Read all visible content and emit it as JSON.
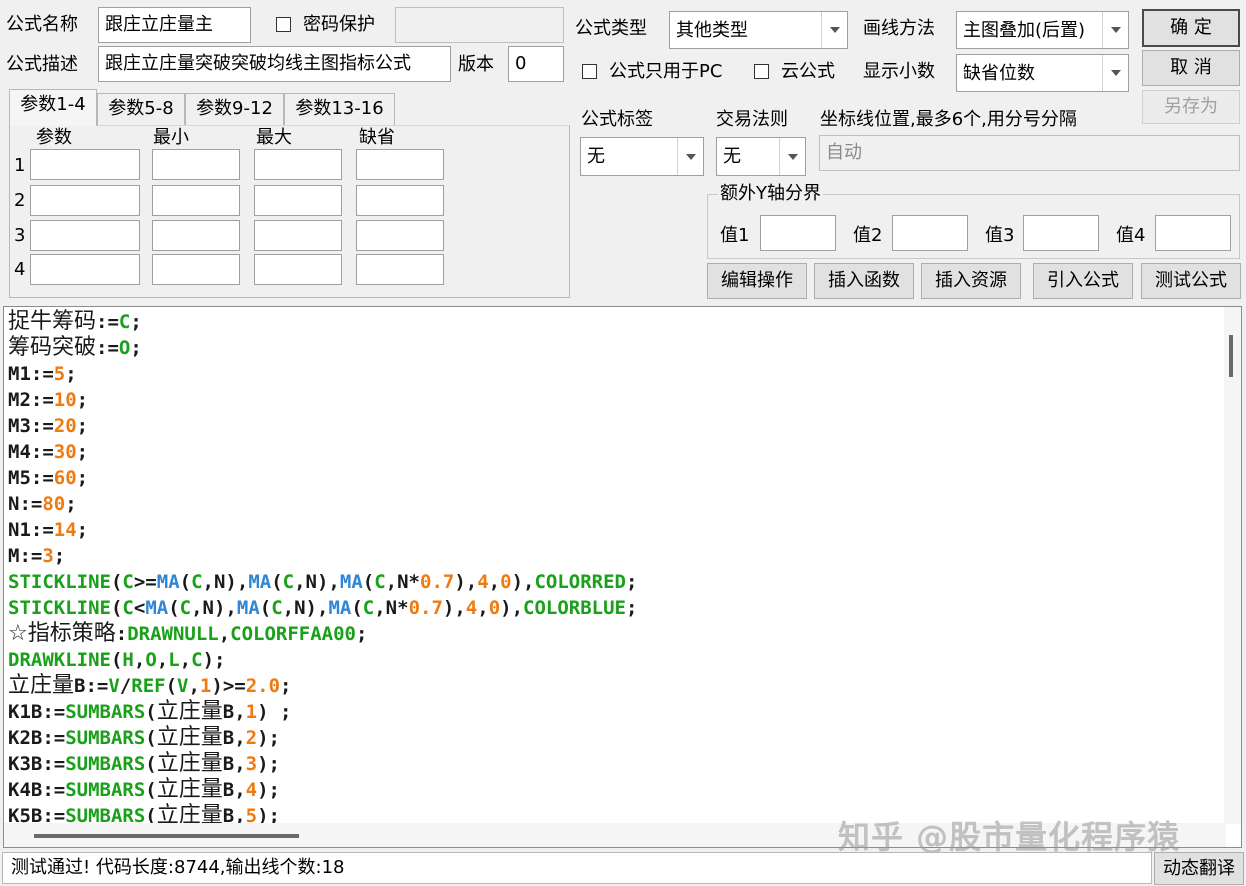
{
  "header": {
    "name_label": "公式名称",
    "name_value": "跟庄立庄量主",
    "password_label": "密码保护",
    "password_value": "",
    "desc_label": "公式描述",
    "desc_value": "跟庄立庄量突破突破均线主图指标公式",
    "version_label": "版本",
    "version_value": "0",
    "type_label": "公式类型",
    "type_value": "其他类型",
    "draw_label": "画线方法",
    "draw_value": "主图叠加(后置)",
    "pc_only_label": "公式只用于PC",
    "cloud_label": "云公式",
    "decimal_label": "显示小数",
    "decimal_value": "缺省位数"
  },
  "buttons": {
    "ok": "确 定",
    "cancel": "取 消",
    "save_as": "另存为",
    "edit_ops": "编辑操作",
    "insert_func": "插入函数",
    "insert_res": "插入资源",
    "import_formula": "引入公式",
    "test_formula": "测试公式",
    "dynamic_translate": "动态翻译"
  },
  "tabs": [
    "参数1-4",
    "参数5-8",
    "参数9-12",
    "参数13-16"
  ],
  "params": {
    "columns": [
      "参数",
      "最小",
      "最大",
      "缺省"
    ],
    "rows": [
      "1",
      "2",
      "3",
      "4"
    ]
  },
  "right": {
    "tag_label": "公式标签",
    "tag_value": "无",
    "rule_label": "交易法则",
    "rule_value": "无",
    "coord_label": "坐标线位置,最多6个,用分号分隔",
    "coord_value": "自动",
    "yaxis_label": "额外Y轴分界",
    "v1": "值1",
    "v2": "值2",
    "v3": "值3",
    "v4": "值4"
  },
  "code_lines": [
    [
      [
        "c",
        "捉牛筹码"
      ],
      [
        "d",
        ":="
      ],
      [
        "g",
        "C"
      ],
      [
        "d",
        ";"
      ]
    ],
    [
      [
        "c",
        "筹码突破"
      ],
      [
        "d",
        ":="
      ],
      [
        "g",
        "O"
      ],
      [
        "d",
        ";"
      ]
    ],
    [
      [
        "d",
        "M1:="
      ],
      [
        "o",
        "5"
      ],
      [
        "d",
        ";"
      ]
    ],
    [
      [
        "d",
        "M2:="
      ],
      [
        "o",
        "10"
      ],
      [
        "d",
        ";"
      ]
    ],
    [
      [
        "d",
        "M3:="
      ],
      [
        "o",
        "20"
      ],
      [
        "d",
        ";"
      ]
    ],
    [
      [
        "d",
        "M4:="
      ],
      [
        "o",
        "30"
      ],
      [
        "d",
        ";"
      ]
    ],
    [
      [
        "d",
        "M5:="
      ],
      [
        "o",
        "60"
      ],
      [
        "d",
        ";"
      ]
    ],
    [
      [
        "d",
        "N:="
      ],
      [
        "o",
        "80"
      ],
      [
        "d",
        ";"
      ]
    ],
    [
      [
        "d",
        "N1:="
      ],
      [
        "o",
        "14"
      ],
      [
        "d",
        ";"
      ]
    ],
    [
      [
        "d",
        "M:="
      ],
      [
        "o",
        "3"
      ],
      [
        "d",
        ";"
      ]
    ],
    [
      [
        "g",
        "STICKLINE"
      ],
      [
        "d",
        "("
      ],
      [
        "g",
        "C"
      ],
      [
        "d",
        ">="
      ],
      [
        "b",
        "MA"
      ],
      [
        "d",
        "("
      ],
      [
        "g",
        "C"
      ],
      [
        "d",
        ",N),"
      ],
      [
        "b",
        "MA"
      ],
      [
        "d",
        "("
      ],
      [
        "g",
        "C"
      ],
      [
        "d",
        ",N),"
      ],
      [
        "b",
        "MA"
      ],
      [
        "d",
        "("
      ],
      [
        "g",
        "C"
      ],
      [
        "d",
        ",N*"
      ],
      [
        "o",
        "0.7"
      ],
      [
        "d",
        "),"
      ],
      [
        "o",
        "4"
      ],
      [
        "d",
        ","
      ],
      [
        "o",
        "0"
      ],
      [
        "d",
        "),"
      ],
      [
        "g",
        "COLORRED"
      ],
      [
        "d",
        ";"
      ]
    ],
    [
      [
        "g",
        "STICKLINE"
      ],
      [
        "d",
        "("
      ],
      [
        "g",
        "C"
      ],
      [
        "d",
        "<"
      ],
      [
        "b",
        "MA"
      ],
      [
        "d",
        "("
      ],
      [
        "g",
        "C"
      ],
      [
        "d",
        ",N),"
      ],
      [
        "b",
        "MA"
      ],
      [
        "d",
        "("
      ],
      [
        "g",
        "C"
      ],
      [
        "d",
        ",N),"
      ],
      [
        "b",
        "MA"
      ],
      [
        "d",
        "("
      ],
      [
        "g",
        "C"
      ],
      [
        "d",
        ",N*"
      ],
      [
        "o",
        "0.7"
      ],
      [
        "d",
        "),"
      ],
      [
        "o",
        "4"
      ],
      [
        "d",
        ","
      ],
      [
        "o",
        "0"
      ],
      [
        "d",
        "),"
      ],
      [
        "g",
        "COLORBLUE"
      ],
      [
        "d",
        ";"
      ]
    ],
    [
      [
        "c",
        "☆指标策略"
      ],
      [
        "d",
        ":"
      ],
      [
        "g",
        "DRAWNULL"
      ],
      [
        "d",
        ","
      ],
      [
        "g",
        "COLORFFAA00"
      ],
      [
        "d",
        ";"
      ]
    ],
    [
      [
        "g",
        "DRAWKLINE"
      ],
      [
        "d",
        "("
      ],
      [
        "g",
        "H"
      ],
      [
        "d",
        ","
      ],
      [
        "g",
        "O"
      ],
      [
        "d",
        ","
      ],
      [
        "g",
        "L"
      ],
      [
        "d",
        ","
      ],
      [
        "g",
        "C"
      ],
      [
        "d",
        ");"
      ]
    ],
    [
      [
        "c",
        "立庄量"
      ],
      [
        "d",
        "B:="
      ],
      [
        "g",
        "V"
      ],
      [
        "d",
        "/"
      ],
      [
        "g",
        "REF"
      ],
      [
        "d",
        "("
      ],
      [
        "g",
        "V"
      ],
      [
        "d",
        ","
      ],
      [
        "o",
        "1"
      ],
      [
        "d",
        ")>="
      ],
      [
        "o",
        "2.0"
      ],
      [
        "d",
        ";"
      ]
    ],
    [
      [
        "d",
        "K1B:="
      ],
      [
        "g",
        "SUMBARS"
      ],
      [
        "d",
        "("
      ],
      [
        "c",
        "立庄量"
      ],
      [
        "d",
        "B,"
      ],
      [
        "o",
        "1"
      ],
      [
        "d",
        ") ;"
      ]
    ],
    [
      [
        "d",
        "K2B:="
      ],
      [
        "g",
        "SUMBARS"
      ],
      [
        "d",
        "("
      ],
      [
        "c",
        "立庄量"
      ],
      [
        "d",
        "B,"
      ],
      [
        "o",
        "2"
      ],
      [
        "d",
        ");"
      ]
    ],
    [
      [
        "d",
        "K3B:="
      ],
      [
        "g",
        "SUMBARS"
      ],
      [
        "d",
        "("
      ],
      [
        "c",
        "立庄量"
      ],
      [
        "d",
        "B,"
      ],
      [
        "o",
        "3"
      ],
      [
        "d",
        ");"
      ]
    ],
    [
      [
        "d",
        "K4B:="
      ],
      [
        "g",
        "SUMBARS"
      ],
      [
        "d",
        "("
      ],
      [
        "c",
        "立庄量"
      ],
      [
        "d",
        "B,"
      ],
      [
        "o",
        "4"
      ],
      [
        "d",
        ");"
      ]
    ],
    [
      [
        "d",
        "K5B:="
      ],
      [
        "g",
        "SUMBARS"
      ],
      [
        "d",
        "("
      ],
      [
        "c",
        "立庄量"
      ],
      [
        "d",
        "B,"
      ],
      [
        "o",
        "5"
      ],
      [
        "d",
        ");"
      ]
    ]
  ],
  "status": "测试通过! 代码长度:8744,输出线个数:18",
  "watermark": "知乎 @股市量化程序猿",
  "colors": {
    "keyword_green": "#1aa01a",
    "number_orange": "#f07a10",
    "function_blue": "#2f86d4"
  }
}
